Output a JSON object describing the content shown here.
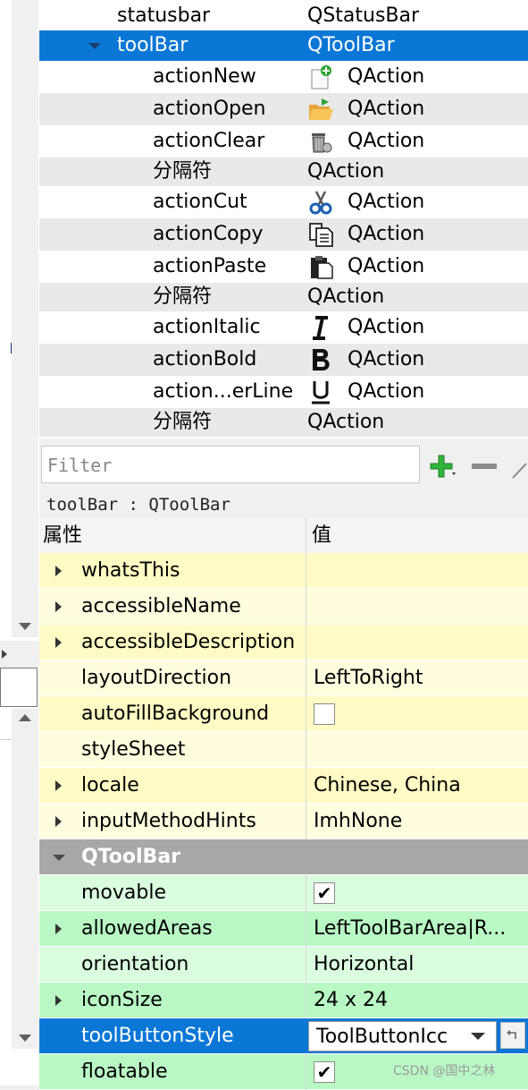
{
  "object_tree": {
    "rows": [
      {
        "name": "statusbar",
        "class": "QStatusBar"
      },
      {
        "name": "toolBar",
        "class": "QToolBar"
      },
      {
        "name": "actionNew",
        "class": "QAction"
      },
      {
        "name": "actionOpen",
        "class": "QAction"
      },
      {
        "name": "actionClear",
        "class": "QAction"
      },
      {
        "name": "分隔符",
        "class": "QAction"
      },
      {
        "name": "actionCut",
        "class": "QAction"
      },
      {
        "name": "actionCopy",
        "class": "QAction"
      },
      {
        "name": "actionPaste",
        "class": "QAction"
      },
      {
        "name": "分隔符",
        "class": "QAction"
      },
      {
        "name": "actionItalic",
        "class": "QAction"
      },
      {
        "name": "actionBold",
        "class": "QAction"
      },
      {
        "name": "action...erLine",
        "class": "QAction"
      },
      {
        "name": "分隔符",
        "class": "QAction"
      }
    ]
  },
  "filter": {
    "placeholder": "Filter"
  },
  "object_label": "toolBar : QToolBar",
  "property_table": {
    "headers": {
      "property": "属性",
      "value": "值"
    },
    "rows": [
      {
        "name": "whatsThis",
        "value": ""
      },
      {
        "name": "accessibleName",
        "value": ""
      },
      {
        "name": "accessibleDescription",
        "value": ""
      },
      {
        "name": "layoutDirection",
        "value": "LeftToRight"
      },
      {
        "name": "autoFillBackground",
        "value": ""
      },
      {
        "name": "styleSheet",
        "value": ""
      },
      {
        "name": "locale",
        "value": "Chinese, China"
      },
      {
        "name": "inputMethodHints",
        "value": "ImhNone"
      },
      {
        "name": "QToolBar",
        "value": ""
      },
      {
        "name": "movable",
        "value": "✔"
      },
      {
        "name": "allowedAreas",
        "value": "LeftToolBarArea|R..."
      },
      {
        "name": "orientation",
        "value": "Horizontal"
      },
      {
        "name": "iconSize",
        "value": "24 x 24"
      },
      {
        "name": "toolButtonStyle",
        "value": "ToolButtonIcc"
      },
      {
        "name": "floatable",
        "value": "✔"
      }
    ]
  },
  "watermark": "CSDN @国中之林",
  "colors": {
    "selection": "#0a77d6",
    "yellow_a": "#fffbc4",
    "yellow_b": "#fffdde",
    "green_a": "#b9f8c4",
    "green_b": "#dbfddf",
    "section": "#a8a8a8"
  }
}
